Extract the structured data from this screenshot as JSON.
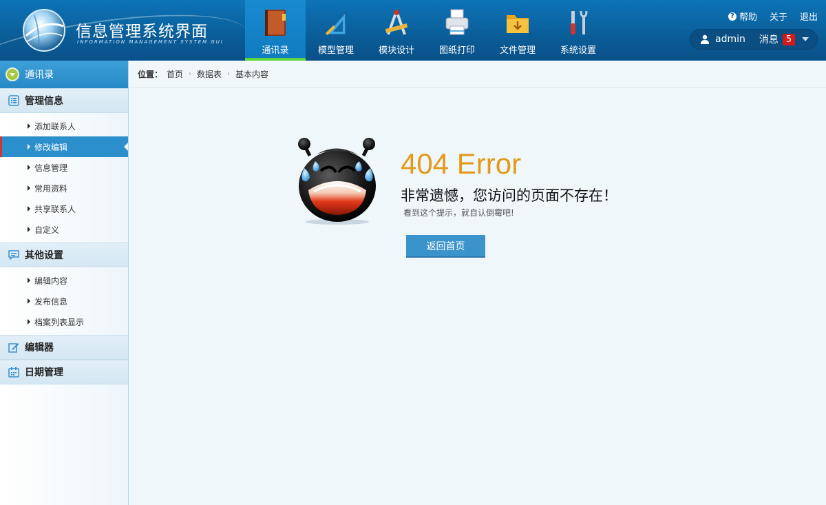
{
  "header": {
    "title": "信息管理系统界面",
    "subtitle": "INFORMATION MANAGEMENT SYSTEM GUI",
    "nav": [
      {
        "label": "通讯录",
        "icon": "address-book-icon",
        "active": true
      },
      {
        "label": "模型管理",
        "icon": "set-square-icon",
        "active": false
      },
      {
        "label": "模块设计",
        "icon": "compass-ruler-icon",
        "active": false
      },
      {
        "label": "图纸打印",
        "icon": "printer-icon",
        "active": false
      },
      {
        "label": "文件管理",
        "icon": "folder-icon",
        "active": false
      },
      {
        "label": "系统设置",
        "icon": "tools-icon",
        "active": false
      }
    ],
    "links": {
      "help": "帮助",
      "about": "关于",
      "logout": "退出"
    },
    "user": {
      "name": "admin",
      "message_label": "消息",
      "message_count": "5"
    }
  },
  "sidebar": {
    "top": "通讯录",
    "groups": [
      {
        "title": "管理信息",
        "icon": "list-icon",
        "items": [
          "添加联系人",
          "修改编辑",
          "信息管理",
          "常用资料",
          "共享联系人",
          "自定义"
        ],
        "active_index": 1
      },
      {
        "title": "其他设置",
        "icon": "chat-icon",
        "items": [
          "编辑内容",
          "发布信息",
          "档案列表显示"
        ]
      },
      {
        "title": "编辑器",
        "icon": "edit-icon",
        "items": []
      },
      {
        "title": "日期管理",
        "icon": "calendar-icon",
        "items": []
      }
    ]
  },
  "breadcrumb": {
    "label": "位置：",
    "items": [
      "首页",
      "数据表",
      "基本内容"
    ]
  },
  "error": {
    "code": "404 Error",
    "message": "非常遗憾，您访问的页面不存在！",
    "hint": "看到这个提示，就自认倒霉吧!",
    "button": "返回首页"
  },
  "colors": {
    "header": "#0a5d98",
    "accent": "#2b8fcb",
    "error": "#e29a18",
    "active_bar": "#5ed53c",
    "badge": "#d21a1a"
  }
}
